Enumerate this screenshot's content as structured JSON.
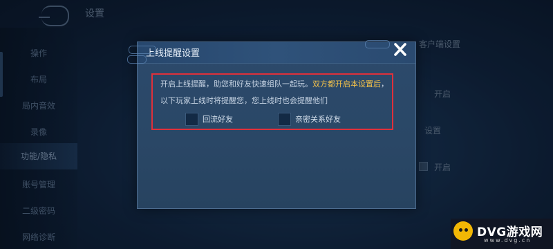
{
  "header": {
    "title": "设置"
  },
  "sidebar": {
    "items": [
      {
        "label": "操作"
      },
      {
        "label": "布局"
      },
      {
        "label": "局内音效"
      },
      {
        "label": "录像"
      },
      {
        "label": "功能/隐私"
      },
      {
        "label": "账号管理"
      },
      {
        "label": "二级密码"
      },
      {
        "label": "网络诊断"
      }
    ],
    "active_index": 4
  },
  "background_right": {
    "label_top": "客户端设置",
    "toggle_1": "开启",
    "label_mid": "设置",
    "toggle_2": "开启"
  },
  "dialog": {
    "title": "上线提醒设置",
    "description_before": "开启上线提醒，助您和好友快速组队一起玩。",
    "description_highlight": "双方都开启本设置后",
    "description_after": "，以下玩家上线时将提醒您，您上线时也会提醒他们",
    "options": [
      {
        "label": "回流好友",
        "checked": false
      },
      {
        "label": "亲密关系好友",
        "checked": false
      }
    ],
    "close_icon": "close-x-icon"
  },
  "watermark": {
    "text": "DVG游戏网",
    "sub": "www.dvg.cn"
  },
  "colors": {
    "highlight": "#f2c14a",
    "outline": "#e0303a",
    "dialog_bg": "#2c4a6c",
    "checkbox_bg": "#132a45"
  }
}
